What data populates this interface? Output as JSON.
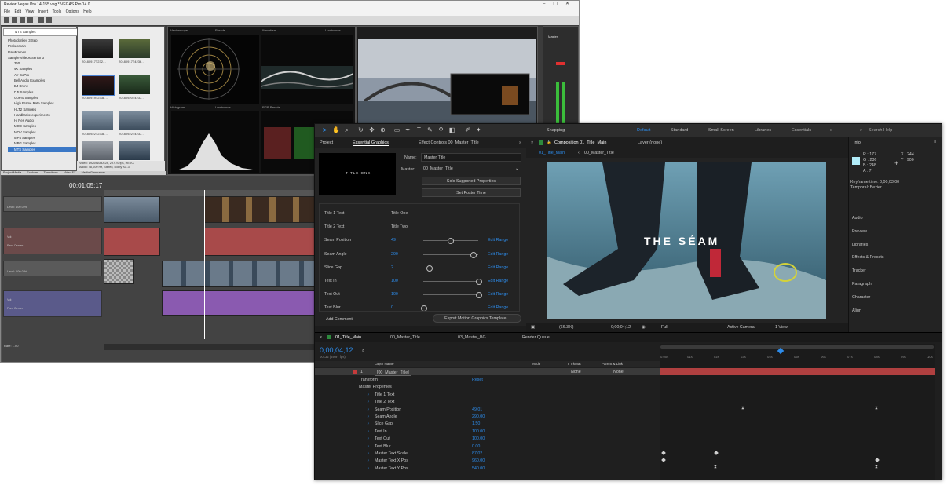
{
  "vegas": {
    "title": "Review Vegas Pro 14-155.veg * VEGAS Pro 14.0",
    "menu": [
      "File",
      "Edit",
      "View",
      "Insert",
      "Tools",
      "Options",
      "Help"
    ],
    "path_field": "NTS Samples",
    "tree_items": [
      "Photodonkey 3 Sep",
      "Prokdomain",
      "RawFrames",
      "Sample Videos Senior 3",
      "360",
      "4K Samples",
      "AV GoPro",
      "Bell Audio Examples",
      "DJ Drone",
      "DJI Samples",
      "GoPro Samples",
      "High Frame Rate Samples",
      "HLT2 Samples",
      "Handbrake experiments",
      "Hi Res Audio",
      "MOD Samples",
      "MOV Samples",
      "MP4 Samples",
      "MPG Samples",
      "MTS Samples"
    ],
    "thumb_labels": [
      "20180917T232…",
      "20180917T4236…",
      "20180919T2338…",
      "20180920T4237…",
      "20180922T2338…",
      "20180922T4237…"
    ],
    "media_info": "Video: 1920x1080x24, 29.970 fps, HEVC\nAudio: 48,000 Hz, Stereo, Dolby AC-3",
    "scope_labels": [
      "Vectorscope",
      "Parade",
      "Waveform",
      "Luminance",
      "Histogram",
      "Luminance",
      "RGB Parade"
    ],
    "bottom_tabs": [
      "Project Media",
      "Explorer",
      "Transitions",
      "Video FX",
      "Media Generators"
    ],
    "timecode": "00:01:05:17",
    "track_levels": [
      "Level: 100.0 %",
      "Vol:",
      "Pan: Center",
      "Level: 100.0 %",
      "Vol:",
      "Pan: Center"
    ],
    "status": "Rate: 1.00",
    "right_label": "Master"
  },
  "ae": {
    "toolbar": {
      "snapping": "Snapping",
      "workspaces": [
        "Default",
        "Standard",
        "Small Screen",
        "Libraries",
        "Essentials"
      ],
      "search_placeholder": "Search Help"
    },
    "eg_panel": {
      "tabs": [
        "Project",
        "Essential Graphics",
        "Effect Controls 00_Master_Title"
      ],
      "thumbnail_text": "TITLE ONE",
      "name_label": "Name:",
      "name_value": "Master Title",
      "master_label": "Master:",
      "master_value": "00_Master_Title",
      "solo_btn": "Solo Supported Properties",
      "poster_btn": "Set Poster Time",
      "props": [
        {
          "label": "Title 1 Text",
          "value": "Title One",
          "slider": -1,
          "link": ""
        },
        {
          "label": "Title 2 Text",
          "value": "Title Two",
          "slider": -1,
          "link": ""
        },
        {
          "label": "Seam Position",
          "value": "49",
          "slider": 0.49,
          "link": "Edit Range"
        },
        {
          "label": "Seam Angle",
          "value": "290",
          "slider": 0.9,
          "link": "Edit Range"
        },
        {
          "label": "Slice Gap",
          "value": "2",
          "slider": 0.1,
          "link": "Edit Range"
        },
        {
          "label": "Text In",
          "value": "100",
          "slider": 1.0,
          "link": "Edit Range"
        },
        {
          "label": "Text Out",
          "value": "100",
          "slider": 1.0,
          "link": "Edit Range"
        },
        {
          "label": "Text Blur",
          "value": "0",
          "slider": 0.0,
          "link": "Edit Range"
        }
      ],
      "add_comment": "Add Comment",
      "export_btn": "Export Motion Graphics Template..."
    },
    "comp": {
      "tab": "Composition 01_Title_Main",
      "layer_tab": "Layer (none)",
      "flow": [
        "01_Title_Main",
        "00_Master_Title"
      ],
      "overlay_text": "THE SÉAM",
      "zoom": "(66.3%)",
      "timecode": "0;00;04;12",
      "resolution": "Full",
      "camera": "Active Camera",
      "views": "1 View"
    },
    "info": {
      "title": "Info",
      "r": "R : 177",
      "g": "G : 236",
      "b": "B : 248",
      "a": "A : 7",
      "x": "X : 244",
      "y": "Y : 900",
      "keyframe_time": "Keyframe time: 0;00;03;00",
      "temporal": "Temporal: Bezier",
      "panels": [
        "Audio",
        "Preview",
        "Libraries",
        "Effects & Presets",
        "Tracker",
        "Paragraph",
        "Character",
        "Align"
      ]
    },
    "timeline": {
      "tabs": [
        "01_Title_Main",
        "00_Master_Title",
        "03_Master_BG",
        "Render Queue"
      ],
      "timecode": "0;00;04;12",
      "frames": "00132 (29.97 fps)",
      "headers": [
        "Layer Name",
        "Mode",
        "T TrkMat",
        "Parent & Link"
      ],
      "layer_num": "1",
      "layer_name": "[00_Master_Title]",
      "mode": "None",
      "parent": "None",
      "rulers": [
        "0:00s",
        "01s",
        "02s",
        "03s",
        "04s",
        "05s",
        "06s",
        "07s",
        "08s",
        "09s",
        "10s"
      ],
      "props": [
        {
          "name": "Transform",
          "value": "Reset"
        },
        {
          "name": "Master Properties",
          "value": ""
        },
        {
          "name": "Title 1 Text",
          "value": ""
        },
        {
          "name": "Title 2 Text",
          "value": ""
        },
        {
          "name": "Seam Position",
          "value": "49.01"
        },
        {
          "name": "Seam Angle",
          "value": "290.00"
        },
        {
          "name": "Slice Gap",
          "value": "1.50"
        },
        {
          "name": "Text In",
          "value": "100.00"
        },
        {
          "name": "Text Out",
          "value": "100.00"
        },
        {
          "name": "Text Blur",
          "value": "0.00"
        },
        {
          "name": "Master Text Scale",
          "value": "87.02"
        },
        {
          "name": "Master Text X Pos",
          "value": "960.00"
        },
        {
          "name": "Master Text Y Pos",
          "value": "540.00"
        }
      ]
    }
  }
}
